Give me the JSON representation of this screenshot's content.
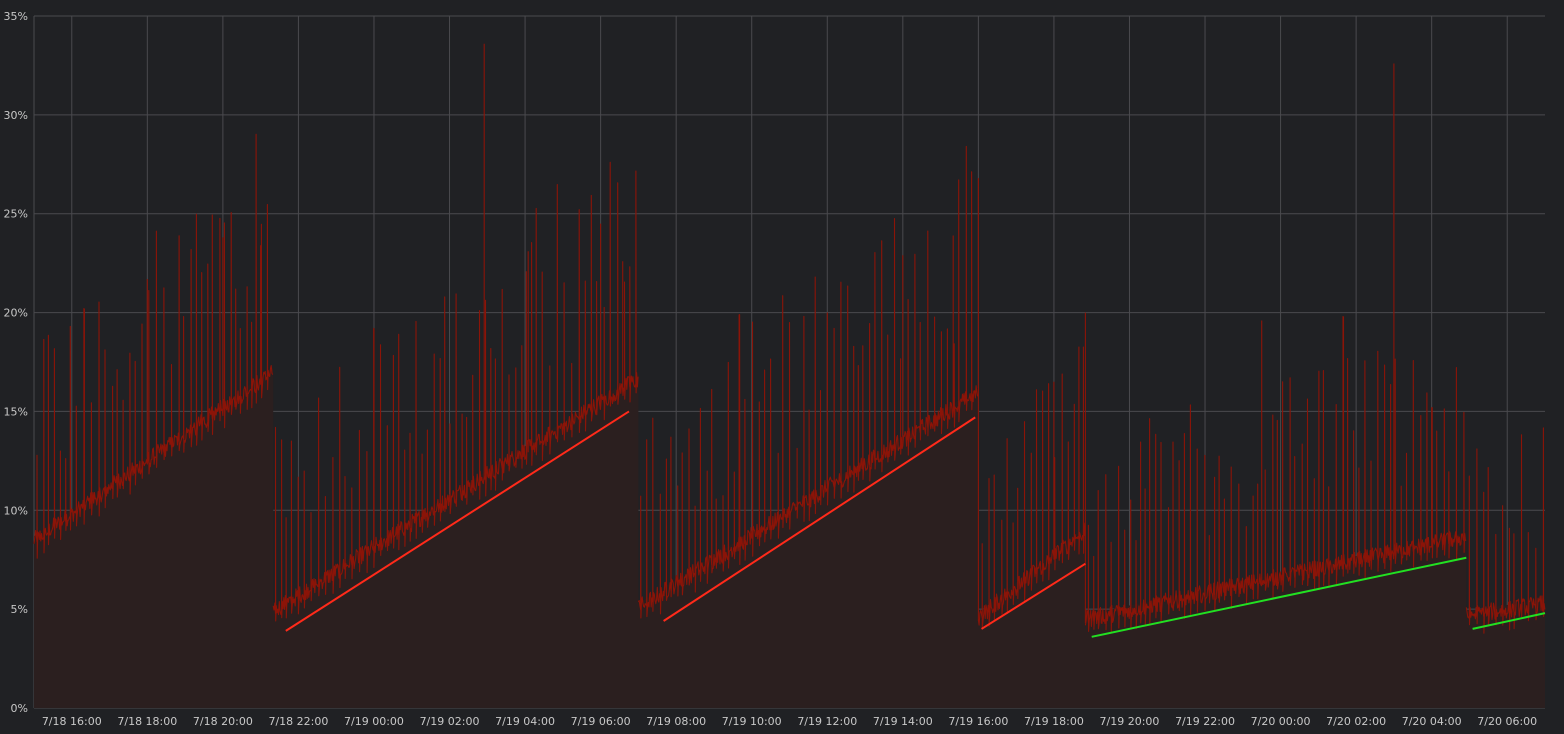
{
  "colors": {
    "background": "#202124",
    "grid": "#4a4a4e",
    "series": "#8b1408",
    "area_fill": "#2b1f1f",
    "red_trend": "#ff2a1a",
    "green_trend": "#22e022"
  },
  "chart_data": {
    "type": "area",
    "grid": true,
    "xlim": [
      "7/18 15:00",
      "7/20 07:00"
    ],
    "ylim": [
      0,
      35
    ],
    "yticks": [
      "0%",
      "5%",
      "10%",
      "15%",
      "20%",
      "25%",
      "30%",
      "35%"
    ],
    "xticks": [
      "7/18 16:00",
      "7/18 18:00",
      "7/18 20:00",
      "7/18 22:00",
      "7/19 00:00",
      "7/19 02:00",
      "7/19 04:00",
      "7/19 06:00",
      "7/19 08:00",
      "7/19 10:00",
      "7/19 12:00",
      "7/19 14:00",
      "7/19 16:00",
      "7/19 18:00",
      "7/19 20:00",
      "7/19 22:00",
      "7/20 00:00",
      "7/20 02:00",
      "7/20 04:00",
      "7/20 06:00"
    ],
    "series": [
      {
        "segments": [
          {
            "start": "7/18 15:00",
            "end": "7/18 21:20",
            "baseline_from": 8.3,
            "baseline_to": 16.8
          },
          {
            "start": "7/18 21:20",
            "end": "7/19 07:00",
            "baseline_from": 4.7,
            "baseline_to": 16.5
          },
          {
            "start": "7/19 07:00",
            "end": "7/19 16:00",
            "baseline_from": 4.9,
            "baseline_to": 15.8
          },
          {
            "start": "7/19 16:00",
            "end": "7/19 18:50",
            "baseline_from": 4.4,
            "baseline_to": 8.8
          },
          {
            "start": "7/19 18:50",
            "end": "7/20 04:55",
            "baseline_from": 4.3,
            "baseline_to": 8.5
          },
          {
            "start": "7/20 04:55",
            "end": "7/20 07:00",
            "baseline_from": 4.5,
            "baseline_to": 5.1
          }
        ],
        "peaks": [
          {
            "x": "7/18 16:20",
            "y": 20.2
          },
          {
            "x": "7/18 18:00",
            "y": 21.7
          },
          {
            "x": "7/18 20:00",
            "y": 23.8
          },
          {
            "x": "7/18 21:00",
            "y": 23.4
          },
          {
            "x": "7/19 00:00",
            "y": 19.2
          },
          {
            "x": "7/19 02:55",
            "y": 33.6
          },
          {
            "x": "7/19 04:05",
            "y": 23.1
          },
          {
            "x": "7/19 06:00",
            "y": 24.5
          },
          {
            "x": "7/19 06:35",
            "y": 22.6
          },
          {
            "x": "7/19 09:40",
            "y": 19.9
          },
          {
            "x": "7/19 11:00",
            "y": 19.5
          },
          {
            "x": "7/19 14:00",
            "y": 22.9
          },
          {
            "x": "7/19 15:20",
            "y": 23.9
          },
          {
            "x": "7/19 16:00",
            "y": 26.8
          },
          {
            "x": "7/19 18:00",
            "y": 16.5
          },
          {
            "x": "7/19 18:50",
            "y": 20.0
          },
          {
            "x": "7/19 23:30",
            "y": 19.6
          },
          {
            "x": "7/20 01:40",
            "y": 19.8
          },
          {
            "x": "7/20 03:00",
            "y": 32.6
          },
          {
            "x": "7/20 04:00",
            "y": 15.2
          }
        ]
      }
    ],
    "trend_lines": [
      {
        "color": "red",
        "from": {
          "x": "7/18 21:40",
          "y": 3.9
        },
        "to": {
          "x": "7/19 06:45",
          "y": 15.0
        }
      },
      {
        "color": "red",
        "from": {
          "x": "7/19 07:40",
          "y": 4.4
        },
        "to": {
          "x": "7/19 15:55",
          "y": 14.7
        }
      },
      {
        "color": "red",
        "from": {
          "x": "7/19 16:05",
          "y": 4.0
        },
        "to": {
          "x": "7/19 18:50",
          "y": 7.3
        }
      },
      {
        "color": "green",
        "from": {
          "x": "7/19 19:00",
          "y": 3.6
        },
        "to": {
          "x": "7/20 04:55",
          "y": 7.6
        }
      },
      {
        "color": "green",
        "from": {
          "x": "7/20 05:05",
          "y": 4.0
        },
        "to": {
          "x": "7/20 07:00",
          "y": 4.8
        }
      }
    ]
  }
}
